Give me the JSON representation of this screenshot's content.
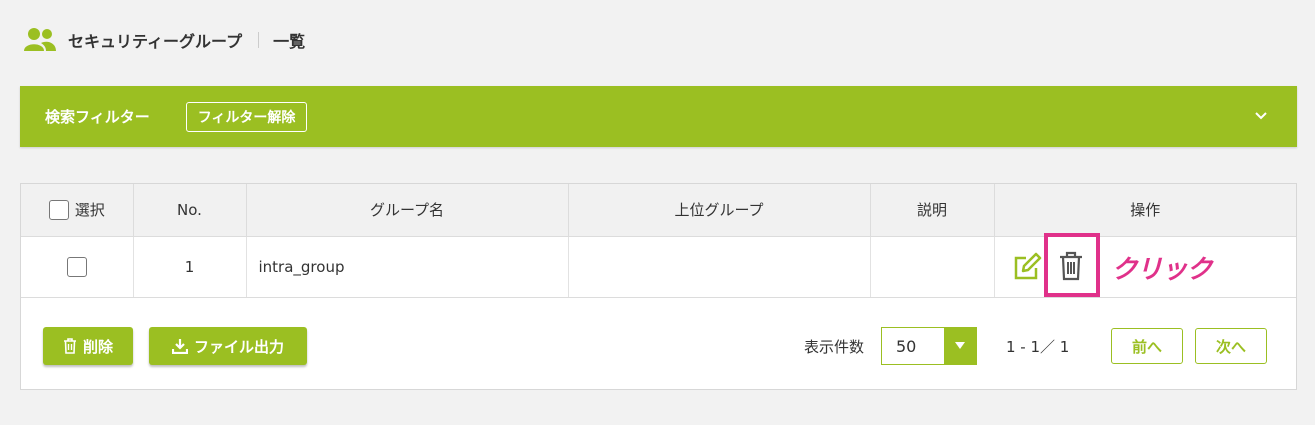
{
  "header": {
    "icon": "users-icon",
    "title": "セキュリティーグループ",
    "subtitle": "一覧"
  },
  "filter": {
    "label": "検索フィルター",
    "clear_label": "フィルター解除"
  },
  "table": {
    "columns": [
      "選択",
      "No.",
      "グループ名",
      "上位グループ",
      "説明",
      "操作"
    ],
    "rows": [
      {
        "no": "1",
        "name": "intra_group",
        "parent": "",
        "description": ""
      }
    ]
  },
  "annotation": {
    "text": "クリック",
    "color": "#e0318a"
  },
  "footer": {
    "delete_label": "削除",
    "export_label": "ファイル出力",
    "per_page_label": "表示件数",
    "per_page_value": "50",
    "pager_info": "1 - 1／ 1",
    "prev_label": "前へ",
    "next_label": "次へ"
  },
  "colors": {
    "accent": "#9bbf22",
    "highlight": "#e0318a",
    "background": "#f2f2f2"
  }
}
